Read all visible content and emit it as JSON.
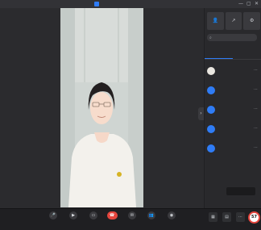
{
  "window": {
    "title": "",
    "controls": [
      "—",
      "▢",
      "✕"
    ]
  },
  "speaker": {
    "name": "",
    "meta": ""
  },
  "sidebar": {
    "tools": [
      {
        "icon": "person-icon",
        "glyph": "👤",
        "label": ""
      },
      {
        "icon": "share-icon",
        "glyph": "↗",
        "label": ""
      },
      {
        "icon": "settings-icon",
        "glyph": "⚙",
        "label": ""
      }
    ],
    "search": {
      "placeholder": ""
    },
    "tabs": [
      {
        "label": "",
        "active": true
      },
      {
        "label": "",
        "active": false
      }
    ],
    "participants": [
      {
        "avatar": "",
        "name": "",
        "role": "",
        "photo": true
      },
      {
        "avatar": "",
        "name": "",
        "role": "",
        "photo": false
      },
      {
        "avatar": "",
        "name": "",
        "role": "",
        "photo": false
      },
      {
        "avatar": "",
        "name": "",
        "role": "",
        "photo": false
      },
      {
        "avatar": "",
        "name": "",
        "role": "",
        "photo": false
      }
    ]
  },
  "toast": {
    "text": "",
    "action": ""
  },
  "toolbar": {
    "logo": "",
    "items": [
      {
        "icon": "microphone-icon",
        "glyph": "🎤",
        "label": "",
        "end": false
      },
      {
        "icon": "camera-icon",
        "glyph": "▶",
        "label": "",
        "end": false
      },
      {
        "icon": "screen-share-icon",
        "glyph": "▭",
        "label": "",
        "end": false
      },
      {
        "icon": "end-call-icon",
        "glyph": "☎",
        "label": "",
        "end": true
      },
      {
        "icon": "chat-icon",
        "glyph": "✉",
        "label": "",
        "end": false
      },
      {
        "icon": "members-icon",
        "glyph": "👥",
        "label": "",
        "end": false
      },
      {
        "icon": "record-icon",
        "glyph": "◉",
        "label": "",
        "end": false
      }
    ],
    "right_items": [
      {
        "icon": "grid-view-icon",
        "glyph": "▦",
        "label": ""
      },
      {
        "icon": "layout-icon",
        "glyph": "▤",
        "label": ""
      },
      {
        "icon": "more-icon",
        "glyph": "⋯",
        "label": ""
      }
    ],
    "network_badge": "57"
  },
  "colors": {
    "accent": "#2f7cf6",
    "danger": "#e5453d",
    "background": "#2b2b2e"
  }
}
